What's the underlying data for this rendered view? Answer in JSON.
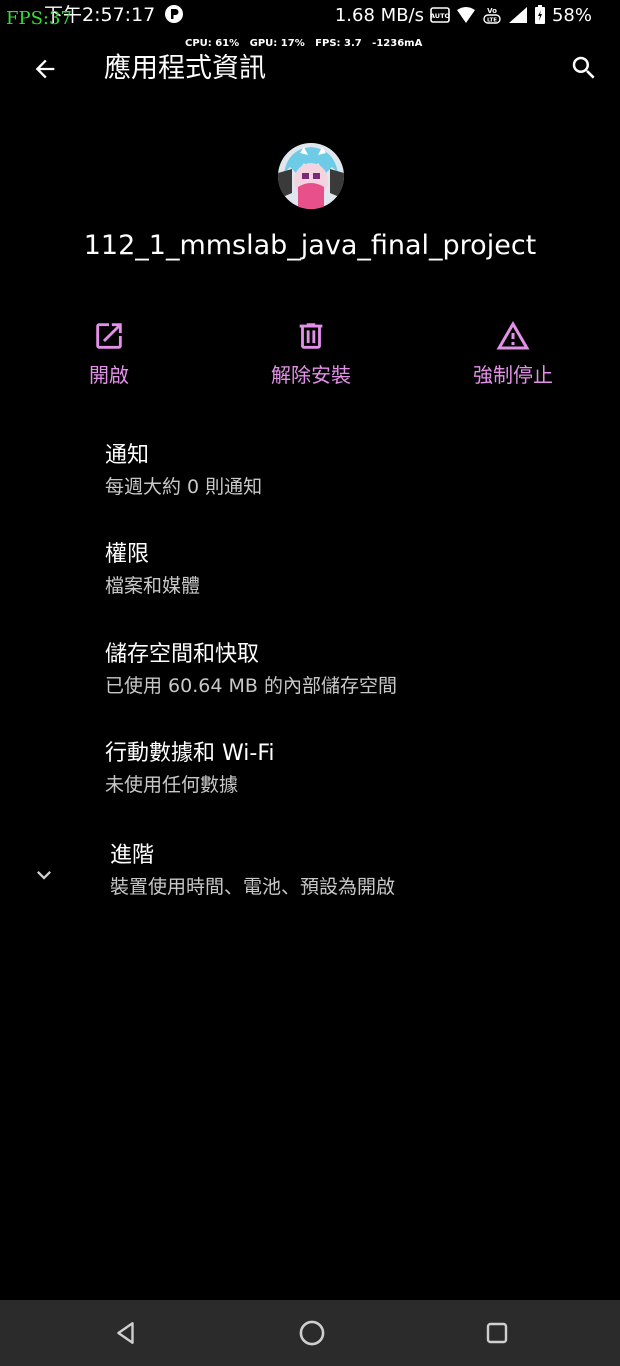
{
  "status_bar": {
    "fps_overlay": "FPS:37",
    "time": "下午2:57:17",
    "net_speed": "1.68 MB/s",
    "battery": "58%",
    "icons": [
      "auto-icon",
      "wifi-icon",
      "volte-icon",
      "signal-icon",
      "battery-icon"
    ]
  },
  "perf_overlay": "CPU: 61%   GPU: 17%   FPS: 3.7   -1236mA",
  "appbar": {
    "title": "應用程式資訊",
    "back_icon": "arrow-back-icon",
    "search_icon": "search-icon"
  },
  "app": {
    "name": "112_1_mmslab_java_final_project",
    "icon": "app-avatar-icon"
  },
  "actions": [
    {
      "label": "開啟",
      "icon": "open-external-icon"
    },
    {
      "label": "解除安裝",
      "icon": "trash-icon"
    },
    {
      "label": "強制停止",
      "icon": "warning-icon"
    }
  ],
  "settings": [
    {
      "title": "通知",
      "subtitle": "每週大約 0 則通知"
    },
    {
      "title": "權限",
      "subtitle": "檔案和媒體"
    },
    {
      "title": "儲存空間和快取",
      "subtitle": "已使用 60.64 MB 的內部儲存空間"
    },
    {
      "title": "行動數據和 Wi-Fi",
      "subtitle": "未使用任何數據"
    }
  ],
  "advanced": {
    "title": "進階",
    "subtitle": "裝置使用時間、電池、預設為開啟",
    "icon": "chevron-down-icon"
  },
  "navbar": {
    "icons": [
      "nav-back-icon",
      "nav-home-icon",
      "nav-recents-icon"
    ]
  },
  "colors": {
    "background": "#000000",
    "accent": "#e391e8",
    "navbar": "#2b2b2b",
    "fps_overlay": "#33dd33"
  }
}
